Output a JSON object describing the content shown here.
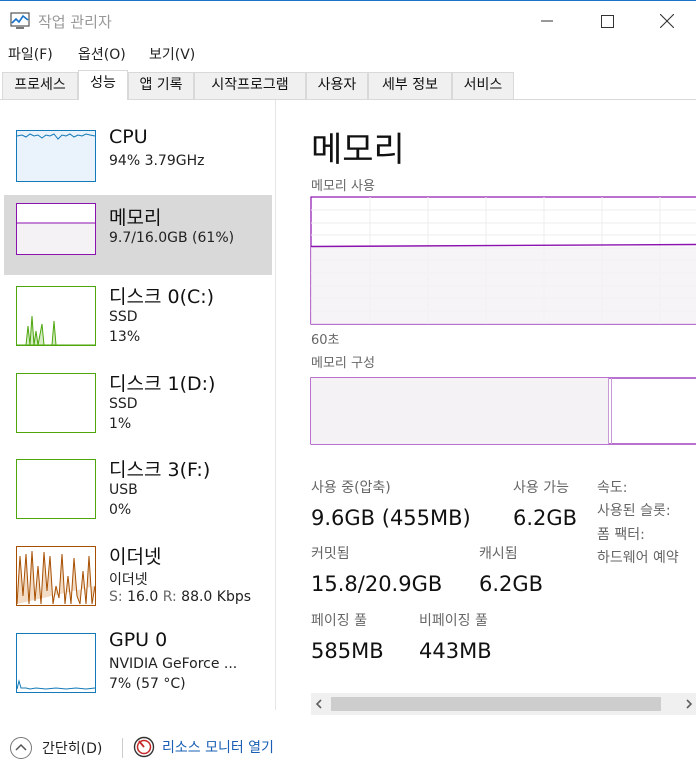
{
  "window": {
    "title": "작업 관리자"
  },
  "menu": [
    {
      "label": "파일(F)"
    },
    {
      "label": "옵션(O)"
    },
    {
      "label": "보기(V)"
    }
  ],
  "tabs": [
    {
      "label": "프로세스"
    },
    {
      "label": "성능"
    },
    {
      "label": "앱 기록"
    },
    {
      "label": "시작프로그램"
    },
    {
      "label": "사용자"
    },
    {
      "label": "세부 정보"
    },
    {
      "label": "서비스"
    }
  ],
  "active_tab": "성능",
  "sidebar": {
    "items": [
      {
        "title": "CPU",
        "line1": "94% 3.79GHz",
        "color": "#1479b8"
      },
      {
        "title": "메모리",
        "line1": "9.7/16.0GB (61%)",
        "color": "#8b12ae",
        "selected": true
      },
      {
        "title": "디스크 0(C:)",
        "line1": "SSD",
        "line2": "13%",
        "color": "#4da60c"
      },
      {
        "title": "디스크 1(D:)",
        "line1": "SSD",
        "line2": "1%",
        "color": "#4da60c"
      },
      {
        "title": "디스크 3(F:)",
        "line1": "USB",
        "line2": "0%",
        "color": "#4da60c"
      },
      {
        "title": "이더넷",
        "line1": "이더넷",
        "send_label": "S:",
        "send_value": "16.0",
        "recv_label": "R:",
        "recv_value": "88.0 Kbps",
        "color": "#a74f01"
      },
      {
        "title": "GPU 0",
        "line1": "NVIDIA GeForce ...",
        "line2": "7% (57 °C)",
        "color": "#1479b8"
      }
    ]
  },
  "main": {
    "title": "메모리",
    "usage_label": "메모리 사용",
    "usage_fraction": 0.61,
    "time_label": "60초",
    "composition_label": "메모리 구성",
    "composition_used_fraction": 0.61,
    "stats": {
      "in_use_label": "사용 중(압축)",
      "in_use_value": "9.6GB (455MB)",
      "available_label": "사용 가능",
      "available_value": "6.2GB",
      "committed_label": "커밋됨",
      "committed_value": "15.8/20.9GB",
      "cached_label": "캐시됨",
      "cached_value": "6.2GB",
      "paged_label": "페이징 풀",
      "paged_value": "585MB",
      "nonpaged_label": "비페이징 풀",
      "nonpaged_value": "443MB"
    },
    "details": {
      "speed_label": "속도:",
      "slots_label": "사용된 슬롯:",
      "form_label": "폼 팩터:",
      "hw_reserved_label": "하드웨어 예약"
    }
  },
  "status": {
    "collapse_label": "간단히(D)",
    "monitor_label": "리소스 모니터 열기"
  },
  "colors": {
    "memory": "#8b12ae",
    "memory_fill": "#f4f2f4",
    "link": "#1a5fb4"
  }
}
